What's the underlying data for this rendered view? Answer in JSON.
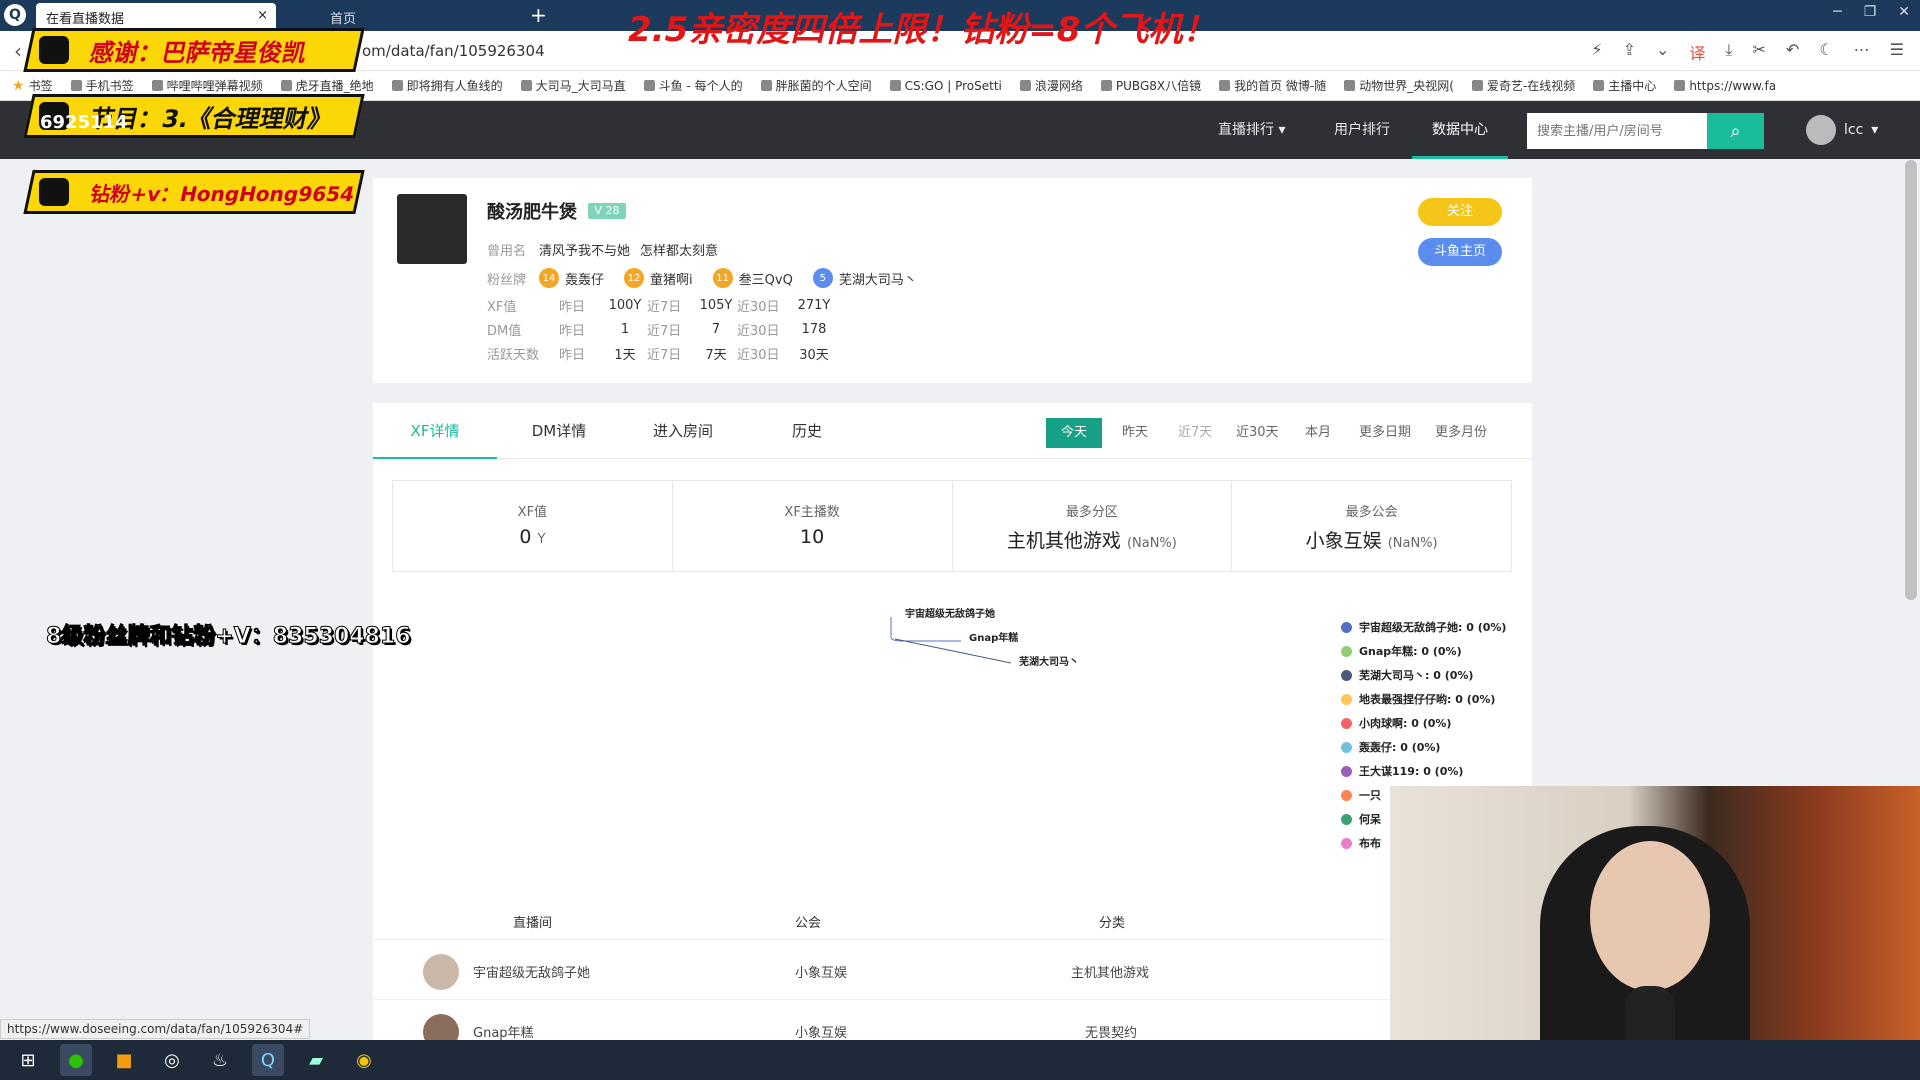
{
  "browser": {
    "tab_active": "在看直播数据",
    "tab_inactive_close": "×",
    "tab_inactive": "首页",
    "url": "om/data/fan/105926304",
    "status_url": "https://www.doseeing.com/data/fan/105926304#",
    "bookmarks": [
      "书签",
      "手机书签",
      "哔哩哔哩弹幕视频",
      "虎牙直播_绝地",
      "即将拥有人鱼线的",
      "大司马_大司马直",
      "斗鱼 - 每个人的",
      "胖胀菌的个人空间",
      "CS:GO | ProSetti",
      "浪漫网络",
      "PUBG8X八倍镜",
      "我的首页 微博-随",
      "动物世界_央视网(",
      "爱奇艺-在线视频",
      "主播中心",
      "https://www.fa"
    ]
  },
  "overlays": {
    "top_red": "2.5亲密度四倍上限！钻粉=8个飞机！",
    "banner1": "感谢：巴萨帝星俊凯",
    "banner2": "节目：3.《合理理财》",
    "banner3": "钻粉+v：HongHong9654",
    "counter": "6925114",
    "side_text": "8级粉丝牌和钻粉+V：835304816"
  },
  "nav": {
    "items": [
      "直播排行",
      "用户排行",
      "数据中心"
    ],
    "search_placeholder": "搜索主播/用户/房间号",
    "username": "lcc"
  },
  "profile": {
    "name": "酸汤肥牛煲",
    "badge": "V 28",
    "used_name_label": "曾用名",
    "used_names": [
      "清风予我不与她",
      "怎样都太刻意"
    ],
    "fan_label": "粉丝牌",
    "fans": [
      {
        "level": "14",
        "name": "轰轰仔",
        "color": "#f5a623"
      },
      {
        "level": "12",
        "name": "童猪啊i",
        "color": "#f5a623"
      },
      {
        "level": "11",
        "name": "叁三QvQ",
        "color": "#f5a623"
      },
      {
        "level": "5",
        "name": "芜湖大司马丶",
        "color": "#5b8def"
      }
    ],
    "rows": [
      {
        "label": "XF值",
        "yesterday": "100Y",
        "week": "105Y",
        "month": "271Y"
      },
      {
        "label": "DM值",
        "yesterday": "1",
        "week": "7",
        "month": "178"
      },
      {
        "label": "活跃天数",
        "yesterday": "1天",
        "week": "7天",
        "month": "30天"
      }
    ],
    "sub_labels": {
      "yesterday": "昨日",
      "week": "近7日",
      "month": "近30日"
    },
    "follow": "关注",
    "douyu_home": "斗鱼主页"
  },
  "details": {
    "tabs": [
      "XF详情",
      "DM详情",
      "进入房间",
      "历史"
    ],
    "ranges": [
      "今天",
      "昨天",
      "近7天",
      "近30天",
      "本月",
      "更多日期",
      "更多月份"
    ],
    "stats": [
      {
        "title": "XF值",
        "value": "0",
        "unit": "Y"
      },
      {
        "title": "XF主播数",
        "value": "10",
        "unit": ""
      },
      {
        "title": "最多分区",
        "value": "主机其他游戏",
        "unit": "(NaN%)"
      },
      {
        "title": "最多公会",
        "value": "小象互娱",
        "unit": "(NaN%)"
      }
    ],
    "pie_labels": [
      "宇宙超级无敌鸽子她",
      "Gnap年糕",
      "芜湖大司马丶"
    ],
    "legend": [
      {
        "text": "宇宙超级无敌鸽子她: 0 (0%)",
        "color": "#5470c6"
      },
      {
        "text": "Gnap年糕: 0 (0%)",
        "color": "#91cc75"
      },
      {
        "text": "芜湖大司马丶: 0 (0%)",
        "color": "#4a5a7a"
      },
      {
        "text": "地表最强捏仔仔哟: 0 (0%)",
        "color": "#fac858"
      },
      {
        "text": "小肉球啊: 0 (0%)",
        "color": "#ee6666"
      },
      {
        "text": "轰轰仔: 0 (0%)",
        "color": "#73c0de"
      },
      {
        "text": "王大谋119: 0 (0%)",
        "color": "#9a60b4"
      },
      {
        "text": "一只",
        "color": "#fc8452"
      },
      {
        "text": "何呆",
        "color": "#3ba272"
      },
      {
        "text": "布布",
        "color": "#ea7ccc"
      }
    ]
  },
  "table": {
    "headers": [
      "直播间",
      "公会",
      "分类"
    ],
    "rows": [
      {
        "room": "宇宙超级无敌鸽子她",
        "guild": "小象互娱",
        "category": "主机其他游戏"
      },
      {
        "room": "Gnap年糕",
        "guild": "小象互娱",
        "category": "无畏契约"
      }
    ]
  }
}
